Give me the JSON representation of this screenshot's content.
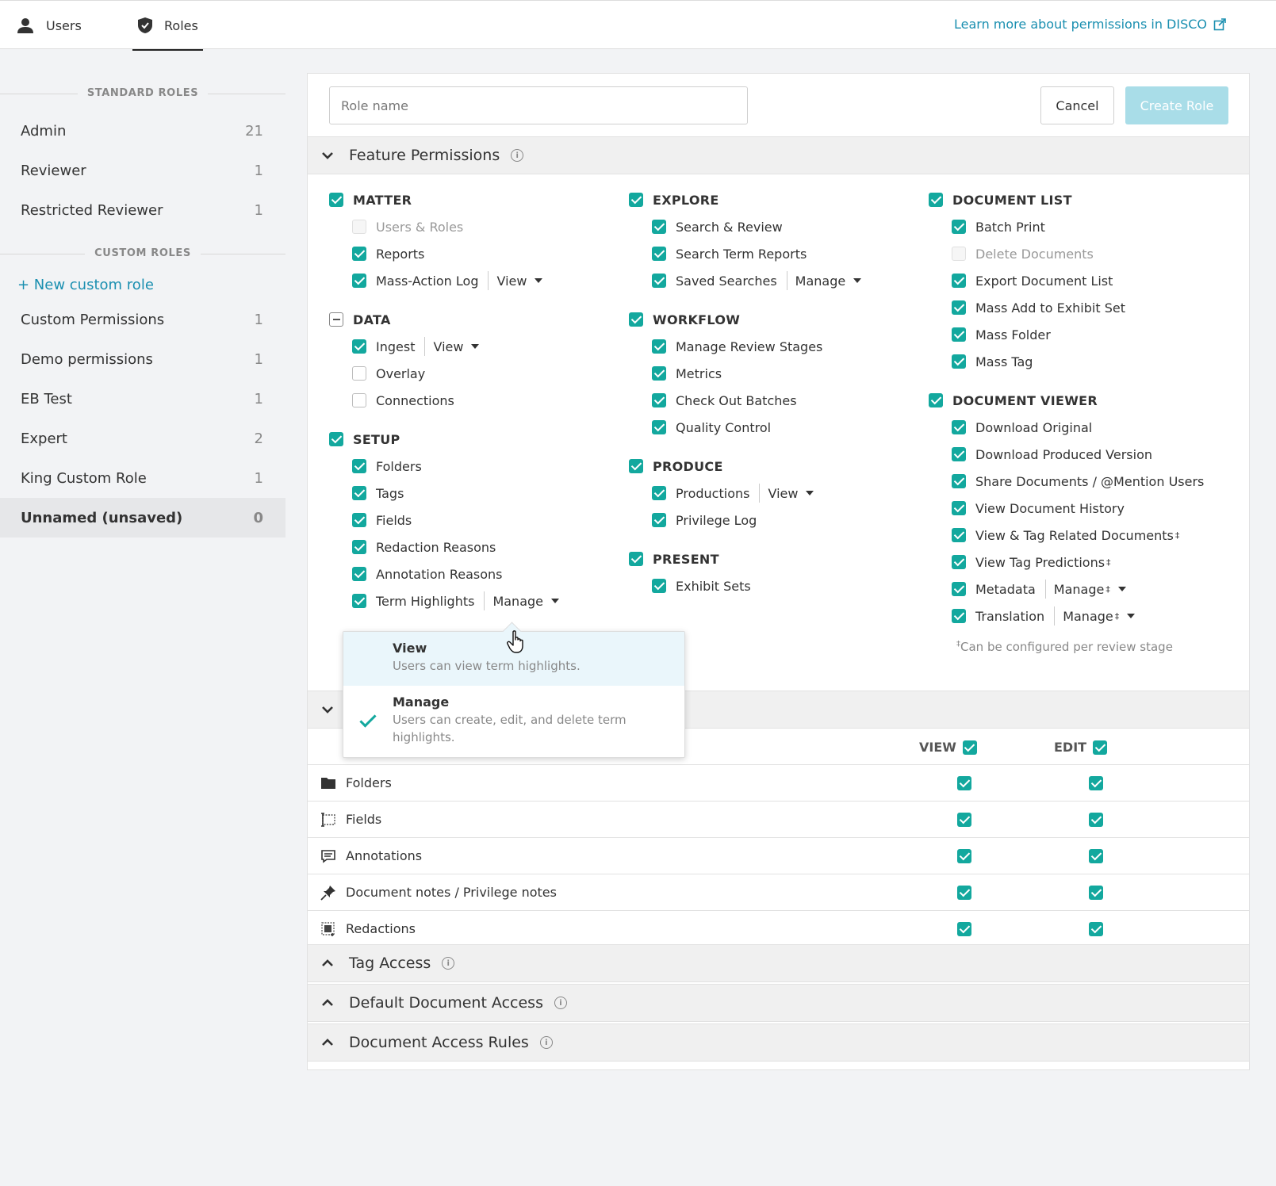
{
  "nav": {
    "tabs": [
      {
        "label": "Users",
        "icon": "user-icon"
      },
      {
        "label": "Roles",
        "icon": "shield-icon"
      }
    ],
    "learn_link": "Learn more about permissions in DISCO"
  },
  "sidebar": {
    "standard_heading": "STANDARD ROLES",
    "standard_roles": [
      {
        "name": "Admin",
        "count": "21"
      },
      {
        "name": "Reviewer",
        "count": "1"
      },
      {
        "name": "Restricted Reviewer",
        "count": "1"
      }
    ],
    "custom_heading": "CUSTOM ROLES",
    "new_role_label": "+ New custom role",
    "custom_roles": [
      {
        "name": "Custom Permissions",
        "count": "1"
      },
      {
        "name": "Demo permissions",
        "count": "1"
      },
      {
        "name": "EB Test",
        "count": "1"
      },
      {
        "name": "Expert",
        "count": "2"
      },
      {
        "name": "King Custom Role",
        "count": "1"
      },
      {
        "name": "Unnamed (unsaved)",
        "count": "0",
        "active": true
      }
    ]
  },
  "form": {
    "role_name_placeholder": "Role name",
    "role_name_value": "",
    "cancel_label": "Cancel",
    "create_label": "Create Role"
  },
  "feature_permissions": {
    "title": "Feature Permissions",
    "matter": {
      "label": "MATTER",
      "state": "on",
      "items": [
        {
          "label": "Users & Roles",
          "state": "disabled"
        },
        {
          "label": "Reports",
          "state": "on"
        },
        {
          "label": "Mass-Action Log",
          "state": "on",
          "level": "View"
        }
      ]
    },
    "data": {
      "label": "DATA",
      "state": "indeterminate",
      "items": [
        {
          "label": "Ingest",
          "state": "on",
          "level": "View"
        },
        {
          "label": "Overlay",
          "state": "off"
        },
        {
          "label": "Connections",
          "state": "off"
        }
      ]
    },
    "setup": {
      "label": "SETUP",
      "state": "on",
      "items": [
        {
          "label": "Folders",
          "state": "on"
        },
        {
          "label": "Tags",
          "state": "on"
        },
        {
          "label": "Fields",
          "state": "on"
        },
        {
          "label": "Redaction Reasons",
          "state": "on"
        },
        {
          "label": "Annotation Reasons",
          "state": "on"
        },
        {
          "label": "Term Highlights",
          "state": "on",
          "level": "Manage"
        }
      ]
    },
    "explore": {
      "label": "EXPLORE",
      "state": "on",
      "items": [
        {
          "label": "Search & Review",
          "state": "on"
        },
        {
          "label": "Search Term Reports",
          "state": "on"
        },
        {
          "label": "Saved Searches",
          "state": "on",
          "level": "Manage"
        }
      ]
    },
    "workflow": {
      "label": "WORKFLOW",
      "state": "on",
      "items": [
        {
          "label": "Manage Review Stages",
          "state": "on"
        },
        {
          "label": "Metrics",
          "state": "on"
        },
        {
          "label": "Check Out Batches",
          "state": "on"
        },
        {
          "label": "Quality Control",
          "state": "on"
        }
      ]
    },
    "produce": {
      "label": "PRODUCE",
      "state": "on",
      "items": [
        {
          "label": "Productions",
          "state": "on",
          "level": "View"
        },
        {
          "label": "Privilege Log",
          "state": "on"
        }
      ]
    },
    "present": {
      "label": "PRESENT",
      "state": "on",
      "items": [
        {
          "label": "Exhibit Sets",
          "state": "on"
        }
      ]
    },
    "document_list": {
      "label": "DOCUMENT LIST",
      "state": "on",
      "items": [
        {
          "label": "Batch Print",
          "state": "on"
        },
        {
          "label": "Delete Documents",
          "state": "disabled"
        },
        {
          "label": "Export Document List",
          "state": "on"
        },
        {
          "label": "Mass Add to Exhibit Set",
          "state": "on"
        },
        {
          "label": "Mass Folder",
          "state": "on"
        },
        {
          "label": "Mass Tag",
          "state": "on"
        }
      ]
    },
    "document_viewer": {
      "label": "DOCUMENT VIEWER",
      "state": "on",
      "items": [
        {
          "label": "Download Original",
          "state": "on"
        },
        {
          "label": "Download Produced Version",
          "state": "on"
        },
        {
          "label": "Share Documents / @Mention Users",
          "state": "on"
        },
        {
          "label": "View Document History",
          "state": "on"
        },
        {
          "label": "View & Tag Related Documents",
          "state": "on",
          "dagger": "‡"
        },
        {
          "label": "View Tag Predictions",
          "state": "on",
          "dagger": "‡"
        },
        {
          "label": "Metadata",
          "state": "on",
          "level": "Manage",
          "dagger": "‡"
        },
        {
          "label": "Translation",
          "state": "on",
          "level": "Manage",
          "dagger": "‡"
        }
      ]
    },
    "footnote_mark": "‡",
    "footnote": "Can be configured per review stage"
  },
  "popup": {
    "options": [
      {
        "label": "View",
        "desc": "Users can view term highlights.",
        "selected": false
      },
      {
        "label": "Manage",
        "desc": "Users can create, edit, and delete term highlights.",
        "selected": true
      }
    ]
  },
  "data_access": {
    "view_label": "VIEW",
    "edit_label": "EDIT",
    "rows": [
      {
        "label": "Folders",
        "icon": "folder-icon",
        "view": true,
        "edit": true
      },
      {
        "label": "Fields",
        "icon": "field-icon",
        "view": true,
        "edit": true
      },
      {
        "label": "Annotations",
        "icon": "annotation-icon",
        "view": true,
        "edit": true
      },
      {
        "label": "Document notes / Privilege notes",
        "icon": "pin-icon",
        "view": true,
        "edit": true
      },
      {
        "label": "Redactions",
        "icon": "redaction-icon",
        "view": true,
        "edit": true
      }
    ]
  },
  "sections": [
    {
      "title": "Tag Access"
    },
    {
      "title": "Default Document Access"
    },
    {
      "title": "Document Access Rules"
    }
  ],
  "colors": {
    "accent": "#13a89e",
    "link": "#1a8fb0",
    "create_disabled": "#a9dde8"
  }
}
